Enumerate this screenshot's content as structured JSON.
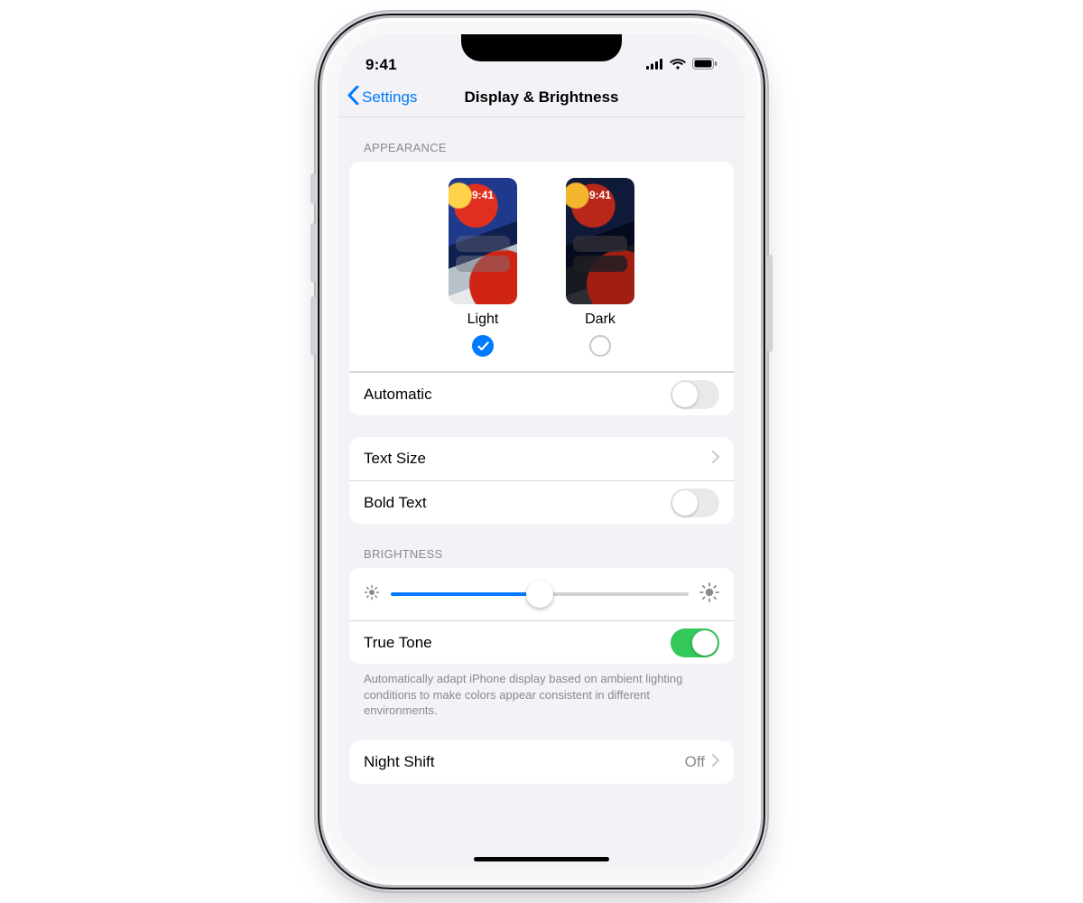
{
  "status": {
    "time": "9:41"
  },
  "nav": {
    "back": "Settings",
    "title": "Display & Brightness"
  },
  "appearance": {
    "header": "APPEARANCE",
    "thumb_time": "9:41",
    "light_label": "Light",
    "dark_label": "Dark",
    "selected": "light",
    "automatic_label": "Automatic",
    "automatic_on": false
  },
  "text": {
    "size_label": "Text Size",
    "bold_label": "Bold Text",
    "bold_on": false
  },
  "brightness": {
    "header": "BRIGHTNESS",
    "value_pct": 50,
    "truetone_label": "True Tone",
    "truetone_on": true,
    "truetone_note": "Automatically adapt iPhone display based on ambient lighting conditions to make colors appear consistent in different environments."
  },
  "nightshift": {
    "label": "Night Shift",
    "value": "Off"
  }
}
